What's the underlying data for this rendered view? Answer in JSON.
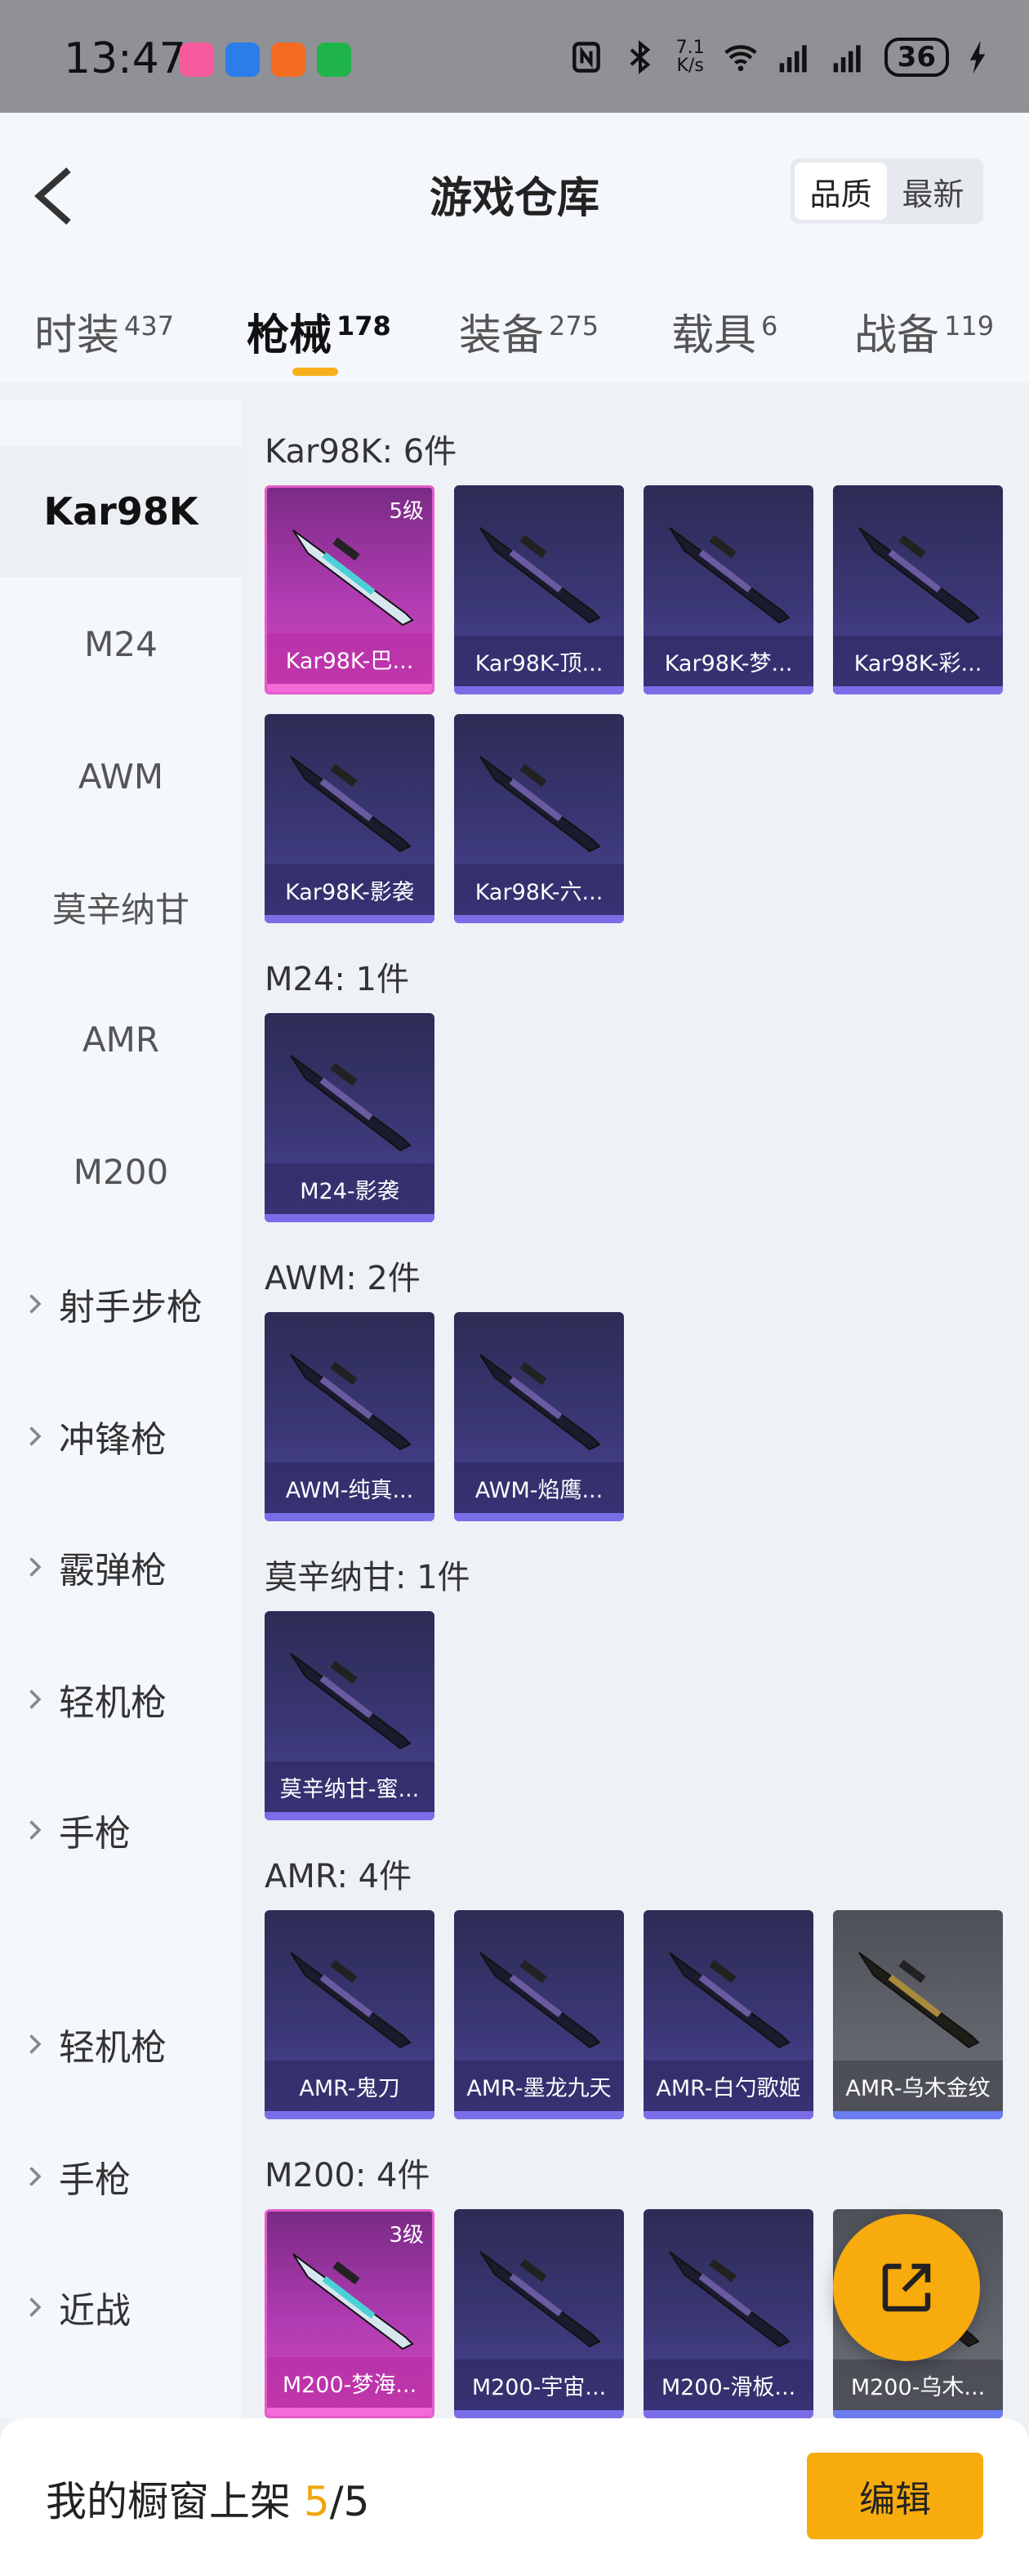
{
  "status_bar": {
    "time": "13:47",
    "net_speed_value": "7.1",
    "net_speed_unit": "K/s",
    "battery": "36"
  },
  "header": {
    "title": "游戏仓库",
    "sort_options": [
      "品质",
      "最新"
    ],
    "active_sort": "品质"
  },
  "tabs": [
    {
      "label": "时装",
      "count": "437"
    },
    {
      "label": "枪械",
      "count": "178",
      "active": true
    },
    {
      "label": "装备",
      "count": "275"
    },
    {
      "label": "载具",
      "count": "6"
    },
    {
      "label": "战备",
      "count": "119"
    }
  ],
  "sidebar": {
    "items": [
      {
        "label": "Kar98K",
        "active": true
      },
      {
        "label": "M24"
      },
      {
        "label": "AWM"
      },
      {
        "label": "莫辛纳甘"
      },
      {
        "label": "AMR"
      },
      {
        "label": "M200"
      },
      {
        "label": "射手步枪",
        "group": true
      },
      {
        "label": "冲锋枪",
        "group": true
      },
      {
        "label": "霰弹枪",
        "group": true
      },
      {
        "label": "轻机枪",
        "group": true
      },
      {
        "label": "手枪",
        "group": true
      },
      {
        "label": "轻机枪",
        "group": true
      },
      {
        "label": "手枪",
        "group": true
      },
      {
        "label": "近战",
        "group": true
      }
    ]
  },
  "sections": [
    {
      "title": "Kar98K: 6件",
      "items": [
        {
          "name": "Kar98K-巴...",
          "style": "pink",
          "level": "5级"
        },
        {
          "name": "Kar98K-顶...",
          "style": "blue"
        },
        {
          "name": "Kar98K-梦...",
          "style": "blue"
        },
        {
          "name": "Kar98K-彩...",
          "style": "blue"
        },
        {
          "name": "Kar98K-影袭",
          "style": "blue"
        },
        {
          "name": "Kar98K-六...",
          "style": "blue"
        }
      ]
    },
    {
      "title": "M24: 1件",
      "items": [
        {
          "name": "M24-影袭",
          "style": "blue"
        }
      ]
    },
    {
      "title": "AWM: 2件",
      "items": [
        {
          "name": "AWM-纯真...",
          "style": "blue"
        },
        {
          "name": "AWM-焰鹰...",
          "style": "blue"
        }
      ]
    },
    {
      "title": "莫辛纳甘: 1件",
      "items": [
        {
          "name": "莫辛纳甘-蜜...",
          "style": "blue"
        }
      ]
    },
    {
      "title": "AMR: 4件",
      "items": [
        {
          "name": "AMR-鬼刀",
          "style": "blue"
        },
        {
          "name": "AMR-墨龙九天",
          "style": "blue"
        },
        {
          "name": "AMR-白勺歌姬",
          "style": "blue"
        },
        {
          "name": "AMR-乌木金纹",
          "style": "gray"
        }
      ]
    },
    {
      "title": "M200: 4件",
      "items": [
        {
          "name": "M200-梦海...",
          "style": "pink",
          "level": "3级"
        },
        {
          "name": "M200-宇宙...",
          "style": "blue"
        },
        {
          "name": "M200-滑板...",
          "style": "blue"
        },
        {
          "name": "M200-乌木...",
          "style": "gray"
        }
      ]
    }
  ],
  "bottom_bar": {
    "showcase_label": "我的橱窗上架",
    "showcase_current": "5",
    "showcase_total": "/5",
    "edit_label": "编辑"
  },
  "colors": {
    "accent": "#f7ab0c",
    "rarity_pink": "#d248b9",
    "rarity_blue": "#4b4697",
    "rarity_gray": "#62646c"
  }
}
